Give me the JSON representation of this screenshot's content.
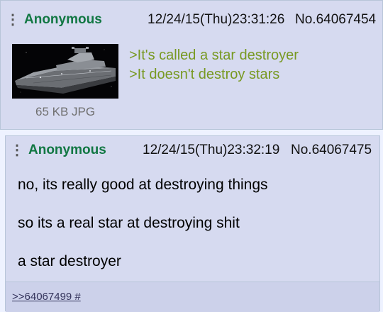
{
  "posts": [
    {
      "menu_icon": "menu-kebab-icon",
      "name": "Anonymous",
      "datetime": "12/24/15(Thu)23:31:26",
      "post_number": "No.64067454",
      "file_info": "65 KB JPG",
      "lines": [
        ">It's called a star destroyer",
        ">It doesn't destroy stars"
      ]
    },
    {
      "menu_icon": "menu-kebab-icon",
      "name": "Anonymous",
      "datetime": "12/24/15(Thu)23:32:19",
      "post_number": "No.64067475",
      "lines": [
        "no, its really good at destroying things",
        "so its a real star at destroying shit",
        "a star destroyer"
      ],
      "backlink": ">>64067499 #"
    }
  ]
}
